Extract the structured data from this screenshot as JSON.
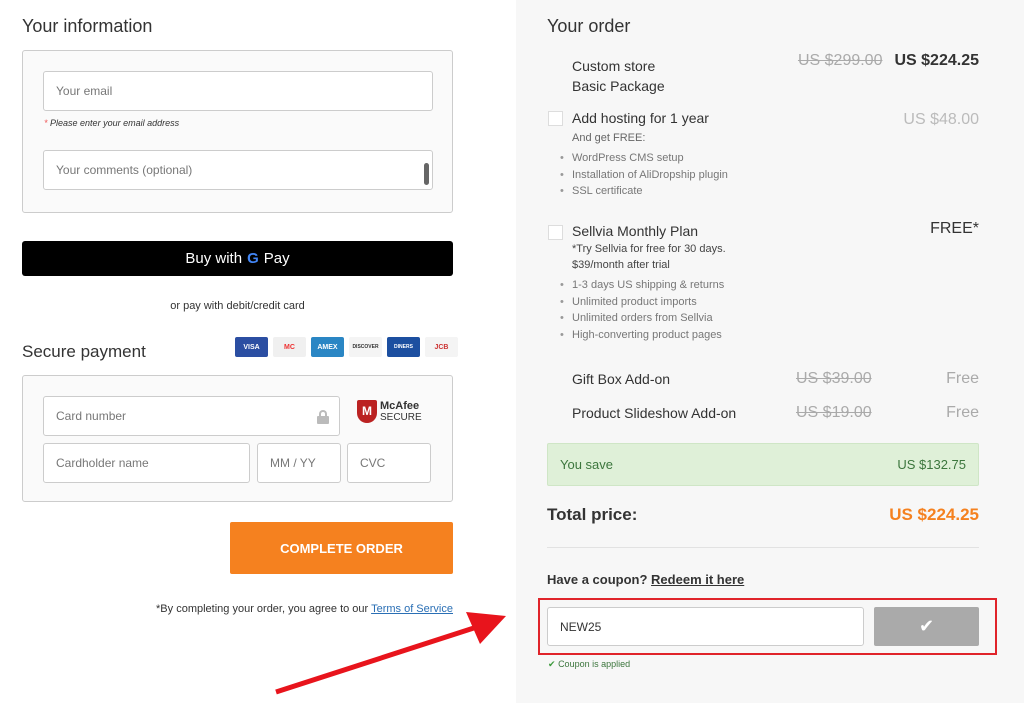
{
  "info": {
    "title": "Your information",
    "email_placeholder": "Your email",
    "email_hint_star": "*",
    "email_hint": "Please enter your email address",
    "comments_placeholder": "Your comments (optional)"
  },
  "gpay": {
    "label_before": "Buy with",
    "g": "G",
    "label_after": "Pay",
    "alt_text": "or pay with debit/credit card"
  },
  "payment": {
    "title": "Secure payment",
    "cards": [
      "VISA",
      "MC",
      "AMEX",
      "DISCOVER",
      "DINERS",
      "JCB"
    ],
    "card_number_placeholder": "Card number",
    "cardholder_placeholder": "Cardholder name",
    "expiry_placeholder": "MM / YY",
    "cvc_placeholder": "CVC",
    "mcafee_name": "McAfee",
    "mcafee_secure": "SECURE",
    "mcafee_badge": "M"
  },
  "complete": {
    "label": "COMPLETE ORDER",
    "color": "#f5811f"
  },
  "terms": {
    "text": "*By completing your order, you agree to our",
    "link": "Terms of Service"
  },
  "order": {
    "title": "Your order",
    "package": {
      "line1": "Custom store",
      "line2": "Basic Package",
      "old_price": "US $299.00",
      "price": "US $224.25"
    },
    "hosting": {
      "title": "Add hosting for 1 year",
      "price": "US $48.00",
      "sub": "And get FREE:",
      "items": [
        "WordPress CMS setup",
        "Installation of AliDropship plugin",
        "SSL certificate"
      ]
    },
    "sellvia": {
      "title": "Sellvia Monthly Plan",
      "price": "FREE*",
      "sub1": "*Try Sellvia for free for 30 days.",
      "sub2": "$39/month after trial",
      "items": [
        "1-3 days US shipping & returns",
        "Unlimited product imports",
        "Unlimited orders from Sellvia",
        "High-converting product pages"
      ]
    },
    "addons": [
      {
        "name": "Gift Box Add-on",
        "old_price": "US $39.00",
        "price": "Free"
      },
      {
        "name": "Product Slideshow Add-on",
        "old_price": "US $19.00",
        "price": "Free"
      }
    ],
    "save": {
      "label": "You save",
      "amount": "US $132.75"
    },
    "total": {
      "label": "Total price:",
      "amount": "US $224.25"
    },
    "coupon": {
      "question": "Have a coupon?",
      "link": "Redeem it here",
      "value": "NEW25",
      "applied": "Coupon is applied"
    }
  }
}
